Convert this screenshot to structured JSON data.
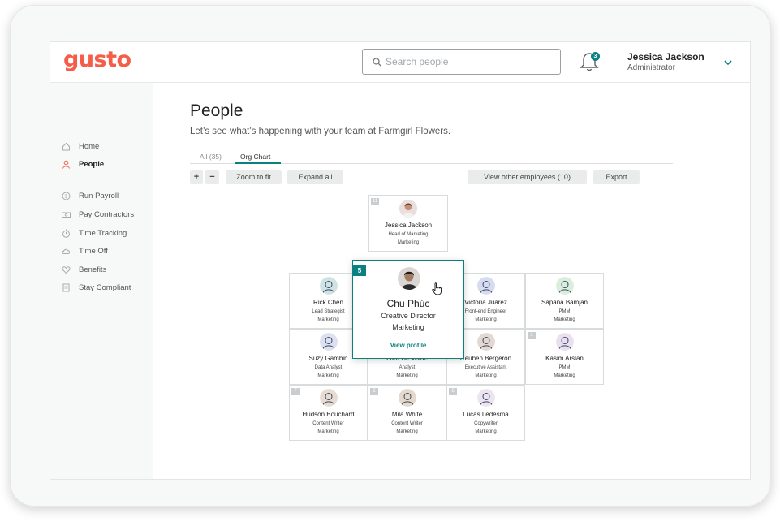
{
  "brand": {
    "logo": "gusto",
    "logo_color": "#f45d48",
    "accent": "#0a8080"
  },
  "header": {
    "search_placeholder": "Search people",
    "notifications_count": "3",
    "user_name": "Jessica Jackson",
    "user_role": "Administrator"
  },
  "sidebar": {
    "items": [
      {
        "label": "Home",
        "icon": "home-icon"
      },
      {
        "label": "People",
        "icon": "person-icon",
        "active": true
      },
      {
        "label": "Run Payroll",
        "icon": "dollar-icon"
      },
      {
        "label": "Pay Contractors",
        "icon": "money-icon"
      },
      {
        "label": "Time Tracking",
        "icon": "stopwatch-icon"
      },
      {
        "label": "Time Off",
        "icon": "cloud-icon"
      },
      {
        "label": "Benefits",
        "icon": "heart-icon"
      },
      {
        "label": "Stay Compliant",
        "icon": "document-icon"
      }
    ]
  },
  "page": {
    "title": "People",
    "subtitle": "Let’s see what’s happening with your team at Farmgirl Flowers."
  },
  "tabs": [
    {
      "label": "All (35)",
      "active": false
    },
    {
      "label": "Org Chart",
      "active": true
    }
  ],
  "toolbar": {
    "zoom_in": "+",
    "zoom_out": "−",
    "zoom_to_fit": "Zoom to fit",
    "expand_all": "Expand all",
    "view_other": "View other employees (10)",
    "export": "Export"
  },
  "org": {
    "manager": {
      "count": "11",
      "name": "Jessica Jackson",
      "title": "Head of Marketing",
      "dept": "Marketing"
    },
    "selected": {
      "count": "5",
      "name": "Chu Phúc",
      "title": "Creative Director",
      "dept": "Marketing",
      "link": "View profile"
    },
    "reports": [
      {
        "name": "Rick Chen",
        "title": "Lead Strategist",
        "dept": "Marketing"
      },
      {
        "name": "Victoria Juárez",
        "title": "Front-end Engineer",
        "dept": "Marketing"
      },
      {
        "name": "Sapana Bamjan",
        "title": "PMM",
        "dept": "Marketing"
      },
      {
        "name": "Suzy Gambin",
        "title": "Data Analyst",
        "dept": "Marketing"
      },
      {
        "name": "Lara De Wilde",
        "title": "Analyst",
        "dept": "Marketing"
      },
      {
        "name": "Reuben Bergeron",
        "title": "Executive Assistant",
        "dept": "Marketing"
      },
      {
        "name": "Kasim Arslan",
        "title": "PMM",
        "dept": "Marketing",
        "count": "1"
      },
      {
        "name": "Hudson Bouchard",
        "title": "Content Writer",
        "dept": "Marketing",
        "count": "7"
      },
      {
        "name": "Mila White",
        "title": "Content Writer",
        "dept": "Marketing",
        "count": "2"
      },
      {
        "name": "Lucas Ledesma",
        "title": "Copywriter",
        "dept": "Marketing",
        "count": "6"
      }
    ]
  }
}
